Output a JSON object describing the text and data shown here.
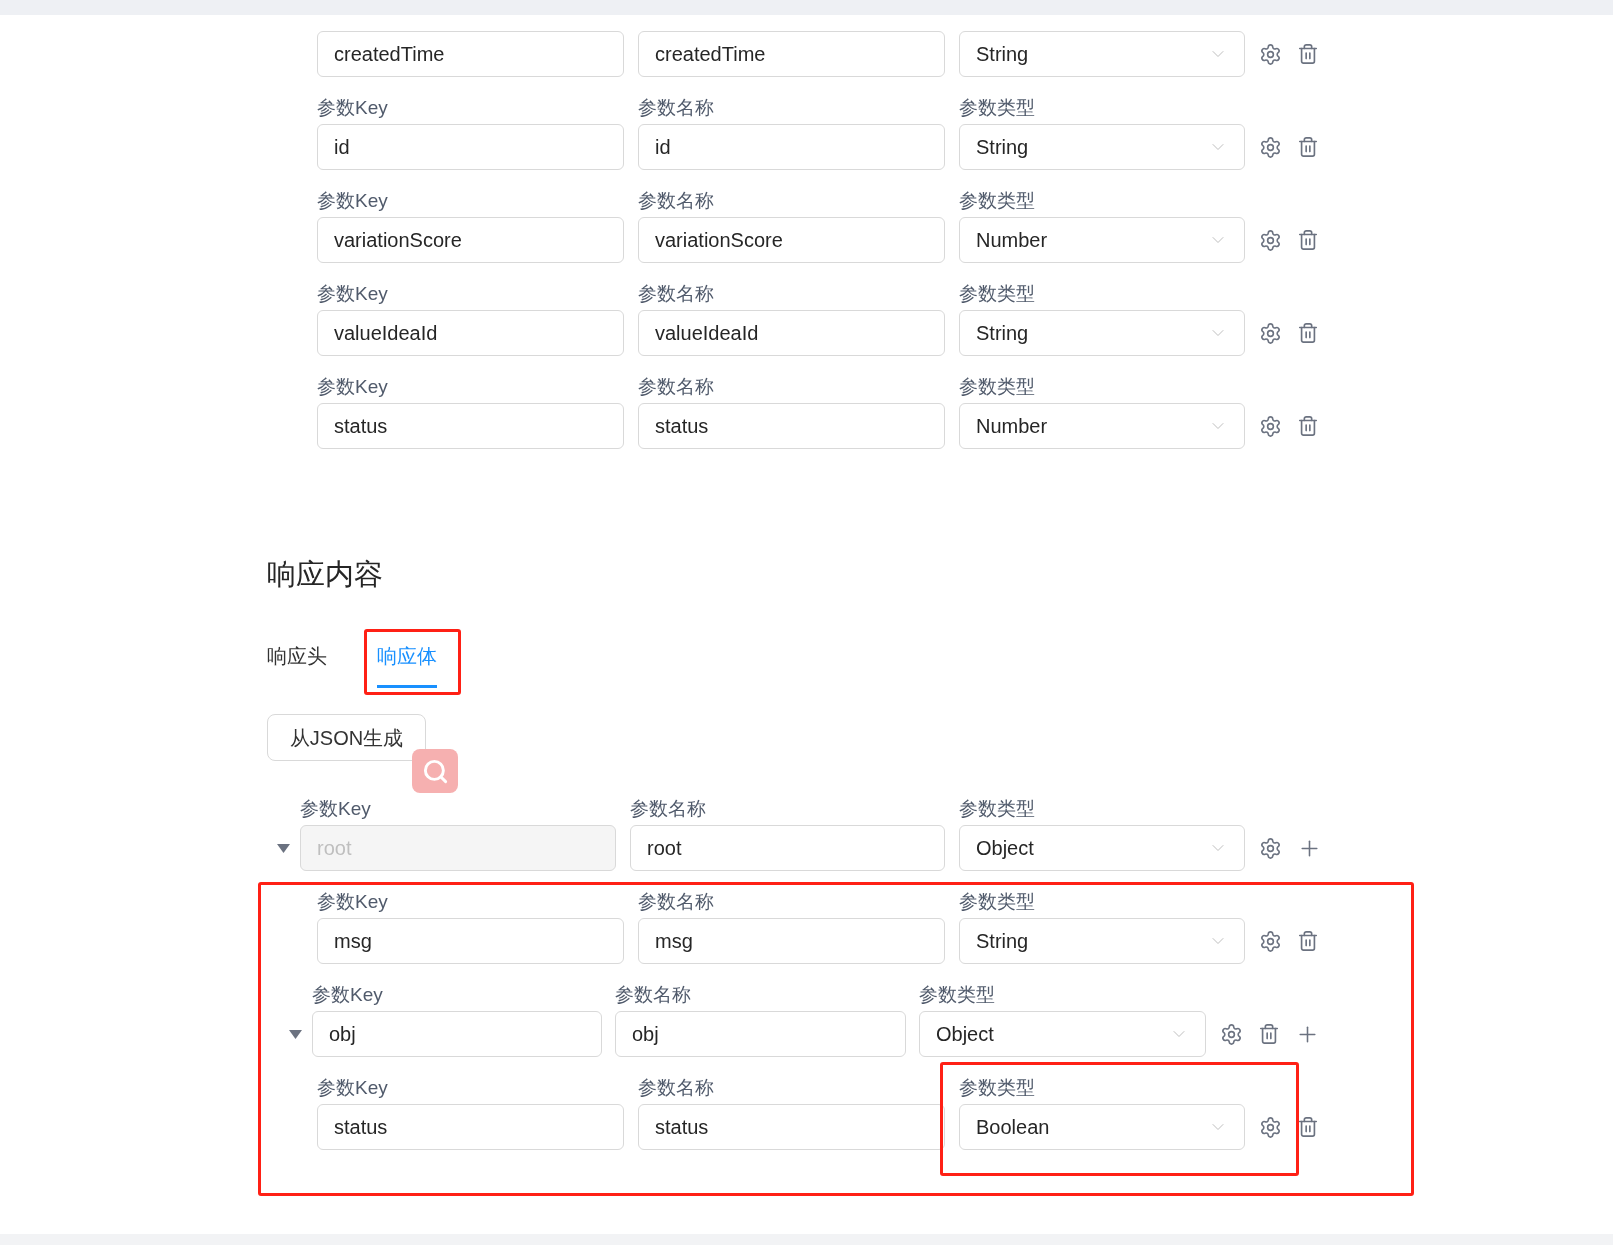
{
  "params": [
    {
      "key": "createdTime",
      "name": "createdTime",
      "type": "String"
    },
    {
      "key_label": "参数Key",
      "name_label": "参数名称",
      "type_label": "参数类型",
      "key": "id",
      "name": "id",
      "type": "String"
    },
    {
      "key_label": "参数Key",
      "name_label": "参数名称",
      "type_label": "参数类型",
      "key": "variationScore",
      "name": "variationScore",
      "type": "Number"
    },
    {
      "key_label": "参数Key",
      "name_label": "参数名称",
      "type_label": "参数类型",
      "key": "valueIdeaId",
      "name": "valueIdeaId",
      "type": "String"
    },
    {
      "key_label": "参数Key",
      "name_label": "参数名称",
      "type_label": "参数类型",
      "key": "status",
      "name": "status",
      "type": "Number"
    }
  ],
  "response": {
    "title": "响应内容",
    "tabs": [
      {
        "label": "响应头",
        "selected": false
      },
      {
        "label": "响应体",
        "selected": true,
        "outlined": true
      }
    ],
    "generate_button": "从JSON生成",
    "tree": {
      "key_label": "参数Key",
      "name_label": "参数名称",
      "type_label": "参数类型",
      "key": "root",
      "name": "root",
      "type": "Object",
      "disabled": true,
      "expanded": true,
      "children_outlined": true,
      "children": [
        {
          "key_label": "参数Key",
          "name_label": "参数名称",
          "type_label": "参数类型",
          "key": "msg",
          "name": "msg",
          "type": "String",
          "disabled": false
        },
        {
          "key_label": "参数Key",
          "name_label": "参数名称",
          "type_label": "参数类型",
          "key": "obj",
          "name": "obj",
          "type": "Object",
          "disabled": false,
          "expanded": true,
          "children": [
            {
              "key_label": "参数Key",
              "name_label": "参数名称",
              "type_label": "参数类型",
              "key": "status",
              "name": "status",
              "type": "Boolean",
              "disabled": false,
              "type_outlined": true
            }
          ]
        }
      ]
    }
  }
}
